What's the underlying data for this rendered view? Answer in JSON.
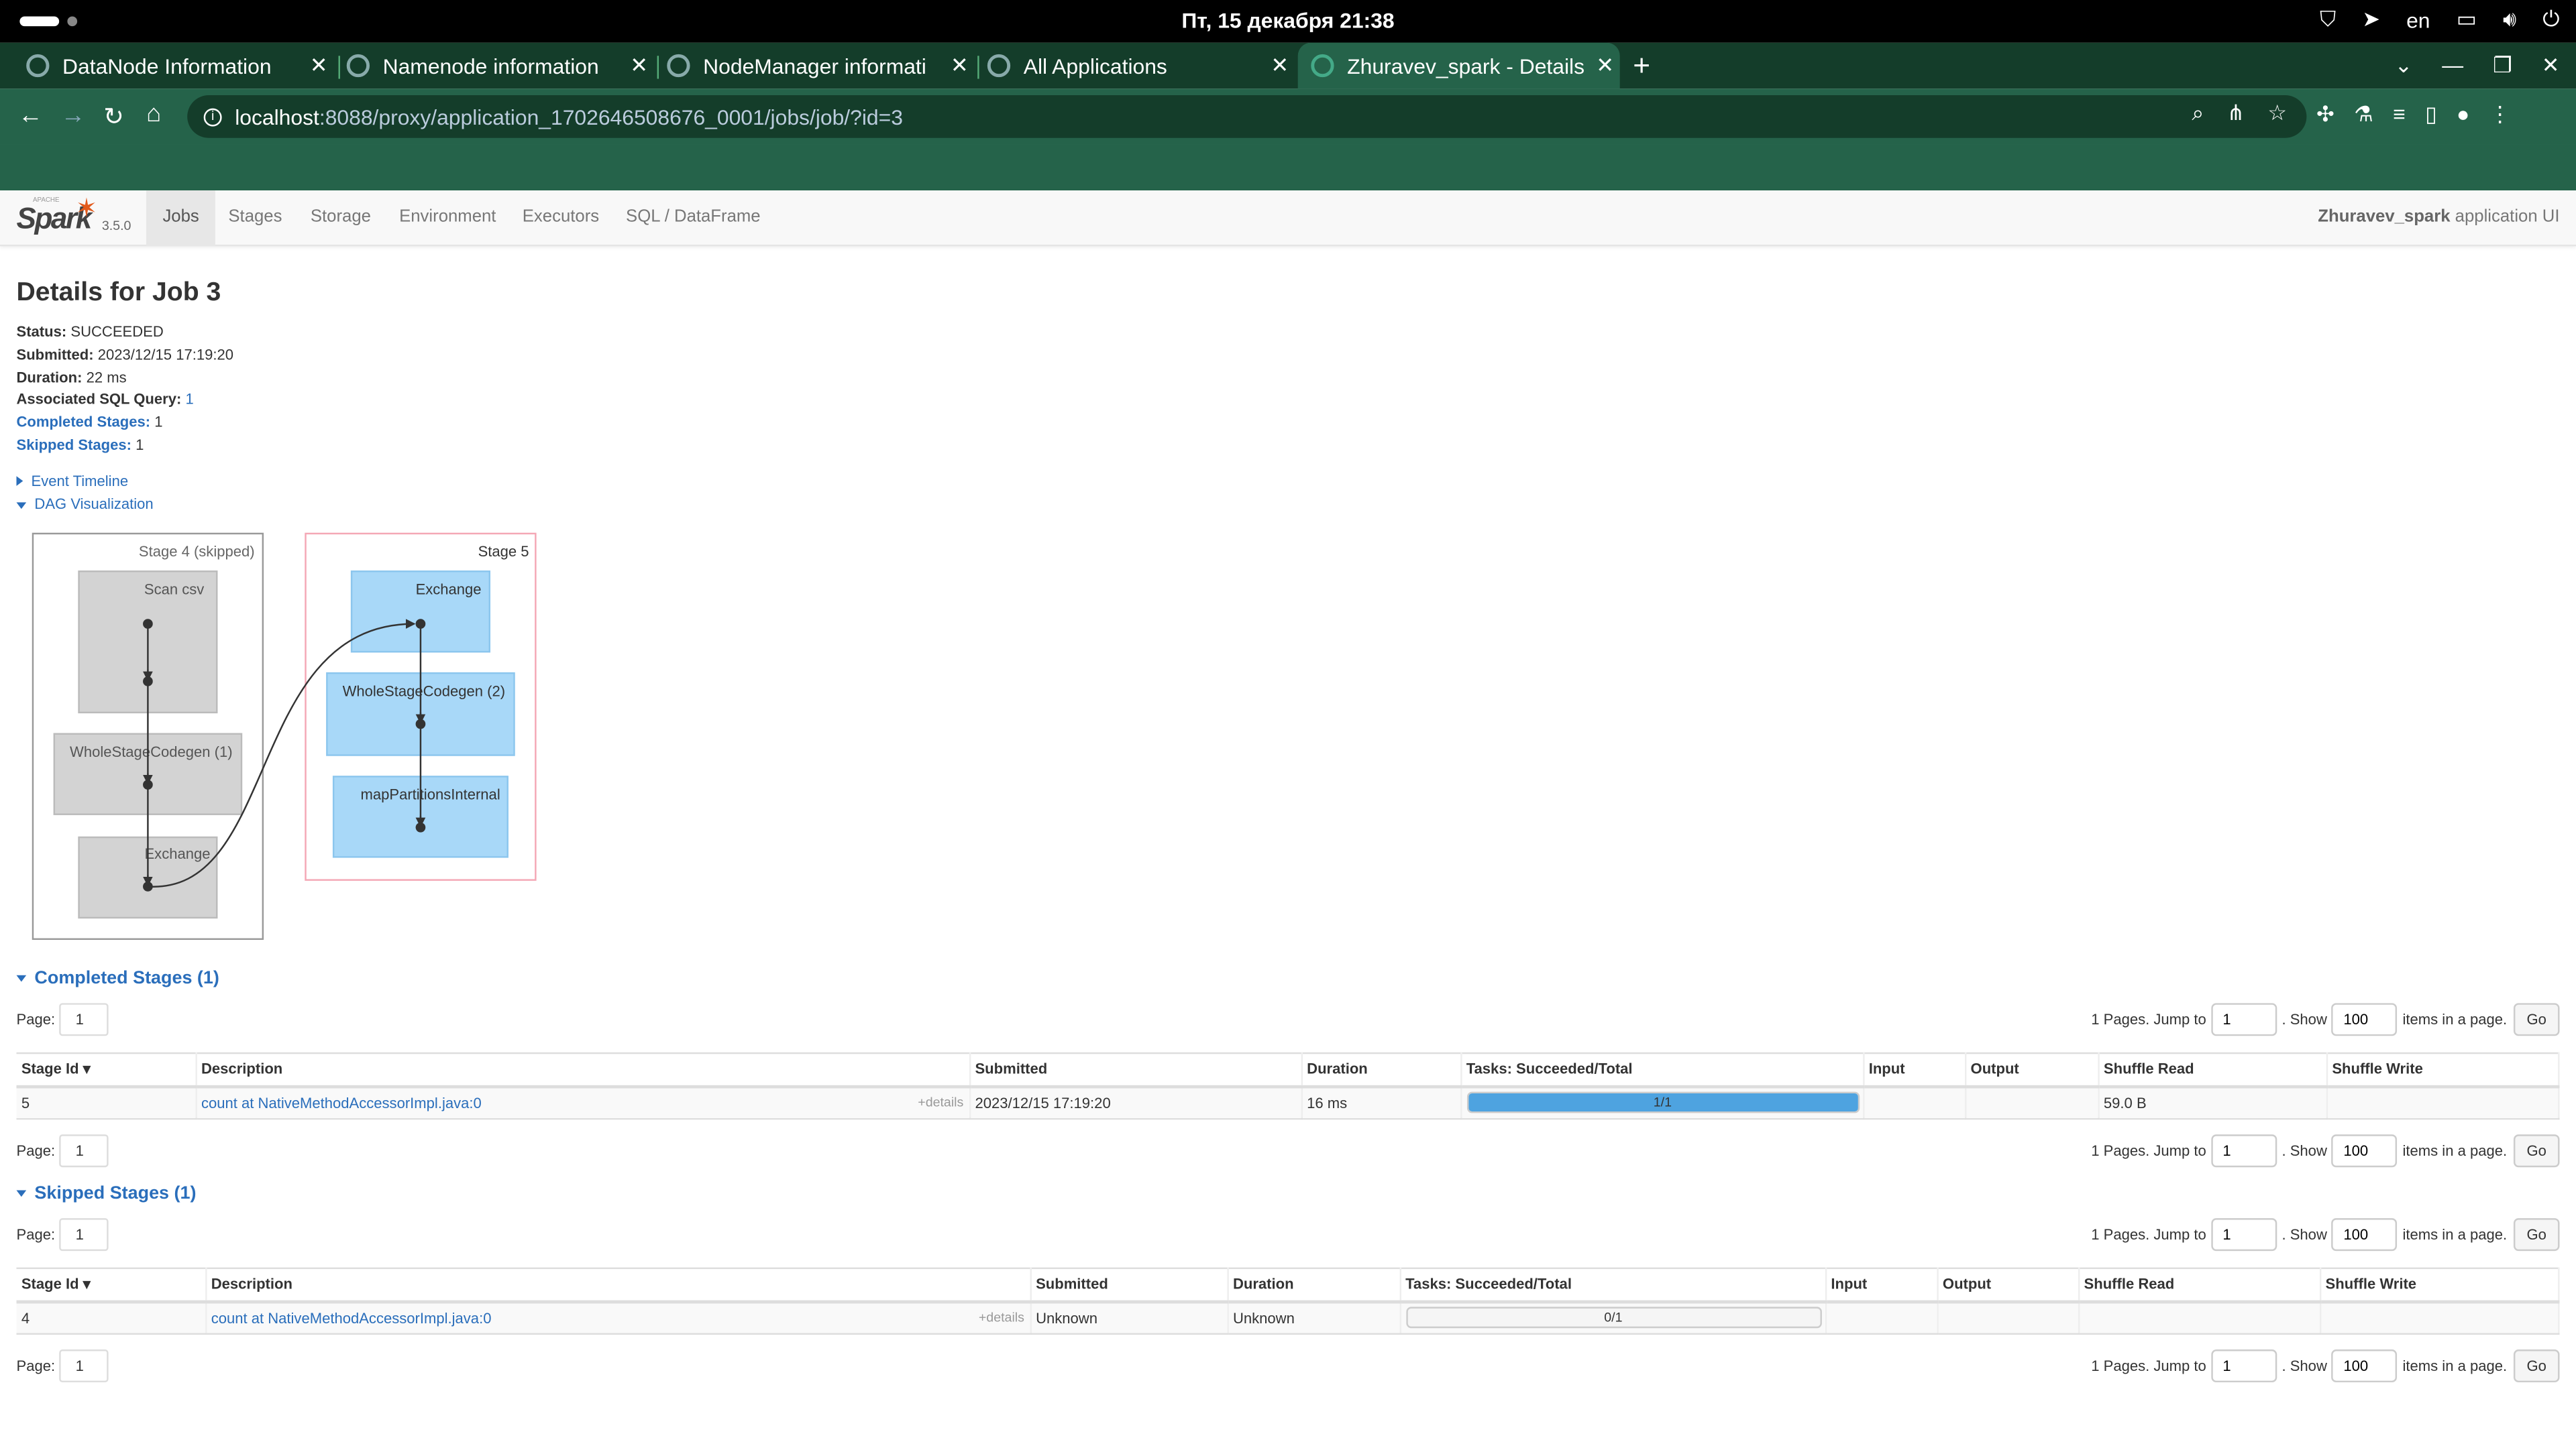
{
  "system_bar": {
    "clock": "Пт, 15 декабря  21:38",
    "lang": "en"
  },
  "browser": {
    "tabs": [
      {
        "title": "DataNode Information"
      },
      {
        "title": "Namenode information"
      },
      {
        "title": "NodeManager informati"
      },
      {
        "title": "All Applications"
      },
      {
        "title": "Zhuravev_spark - Details"
      }
    ],
    "url_host": "localhost",
    "url_rest": ":8088/proxy/application_1702646508676_0001/jobs/job/?id=3"
  },
  "spark": {
    "version": "3.5.0",
    "nav": [
      "Jobs",
      "Stages",
      "Storage",
      "Environment",
      "Executors",
      "SQL / DataFrame"
    ],
    "app_name": "Zhuravev_spark",
    "app_suffix": " application UI"
  },
  "job": {
    "title": "Details for Job 3",
    "status_label": "Status:",
    "status": "SUCCEEDED",
    "submitted_label": "Submitted:",
    "submitted": "2023/12/15 17:19:20",
    "duration_label": "Duration:",
    "duration": "22 ms",
    "sql_label": "Associated SQL Query:",
    "sql": "1",
    "completed_label": "Completed Stages:",
    "completed": "1",
    "skipped_label": "Skipped Stages:",
    "skipped": "1"
  },
  "toggles": {
    "event_timeline": "Event Timeline",
    "dag": "DAG Visualization"
  },
  "dag": {
    "stage4": {
      "label": "Stage 4 (skipped)",
      "nodes": [
        "Scan csv",
        "WholeStageCodegen (1)",
        "Exchange"
      ]
    },
    "stage5": {
      "label": "Stage 5",
      "nodes": [
        "Exchange",
        "WholeStageCodegen (2)",
        "mapPartitionsInternal"
      ]
    }
  },
  "pager": {
    "page_label": "Page:",
    "page": "1",
    "pages_text": "1 Pages. Jump to",
    "show_text": ". Show",
    "items_text": "items in a page.",
    "jump_value": "1",
    "size_value": "100",
    "go": "Go"
  },
  "columns": [
    "Stage Id ▾",
    "Description",
    "Submitted",
    "Duration",
    "Tasks: Succeeded/Total",
    "Input",
    "Output",
    "Shuffle Read",
    "Shuffle Write"
  ],
  "completed_stages": {
    "heading": "Completed Stages (1)",
    "rows": [
      {
        "id": "5",
        "desc": "count at NativeMethodAccessorImpl.java:0",
        "details": "+details",
        "submitted": "2023/12/15 17:19:20",
        "duration": "16 ms",
        "tasks": "1/1",
        "progress": 1.0,
        "input": "",
        "output": "",
        "shuffle_read": "59.0 B",
        "shuffle_write": ""
      }
    ]
  },
  "skipped_stages": {
    "heading": "Skipped Stages (1)",
    "rows": [
      {
        "id": "4",
        "desc": "count at NativeMethodAccessorImpl.java:0",
        "details": "+details",
        "submitted": "Unknown",
        "duration": "Unknown",
        "tasks": "0/1",
        "progress": 0.0,
        "input": "",
        "output": "",
        "shuffle_read": "",
        "shuffle_write": ""
      }
    ]
  },
  "colors": {
    "browser_dark": "#143d2a",
    "browser_green": "#25634a",
    "link": "#2a6ebb",
    "progress": "#4ea3e0",
    "dag_skipped_fill": "#d3d3d3",
    "dag_node_fill": "#a8d8f8",
    "dag_stage5_border": "#f4a7b5"
  }
}
